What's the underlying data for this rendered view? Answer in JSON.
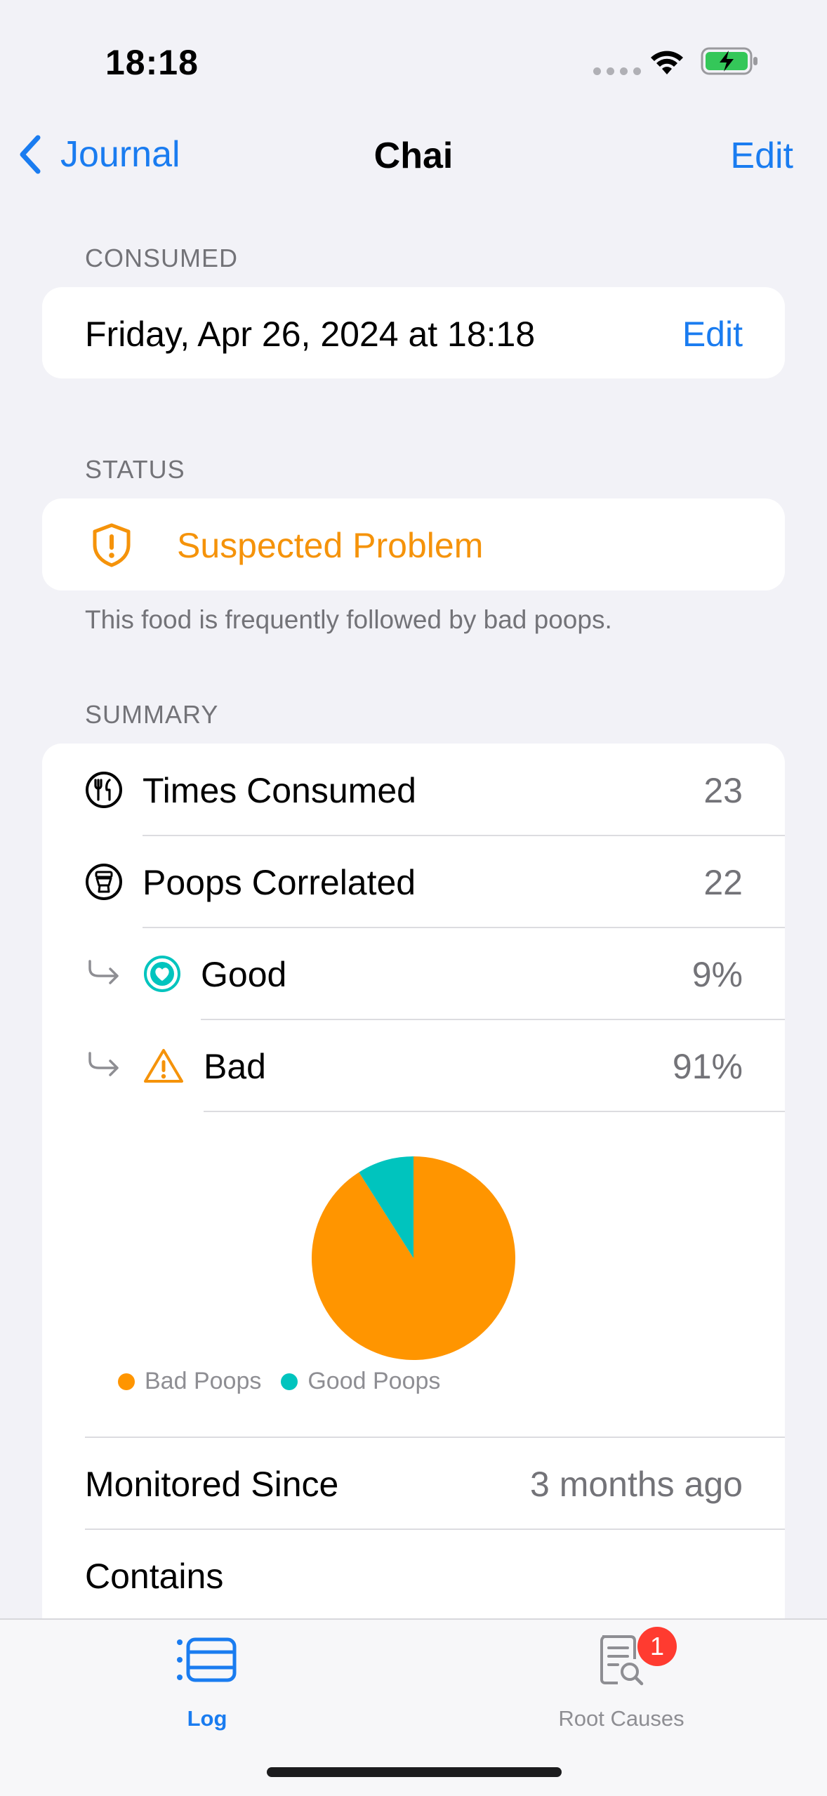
{
  "status_bar": {
    "time": "18:18"
  },
  "nav": {
    "back_label": "Journal",
    "title": "Chai",
    "edit_label": "Edit"
  },
  "consumed": {
    "header": "CONSUMED",
    "date": "Friday, Apr 26, 2024 at 18:18",
    "edit_label": "Edit"
  },
  "status": {
    "header": "STATUS",
    "label": "Suspected Problem",
    "footnote": "This food is frequently followed by bad poops.",
    "color": "#f5930a"
  },
  "summary": {
    "header": "SUMMARY",
    "rows": [
      {
        "icon": "fork-knife-circle-icon",
        "label": "Times Consumed",
        "value": "23"
      },
      {
        "icon": "toilet-circle-icon",
        "label": "Poops Correlated",
        "value": "22"
      },
      {
        "icon": "heart-circle-icon",
        "label": "Good",
        "value": "9%"
      },
      {
        "icon": "warning-triangle-icon",
        "label": "Bad",
        "value": "91%"
      }
    ],
    "monitored_label": "Monitored Since",
    "monitored_value": "3 months ago",
    "contains_label": "Contains"
  },
  "chart_data": {
    "type": "pie",
    "slices": [
      {
        "label": "Bad Poops",
        "value": 91,
        "color": "#ff9500"
      },
      {
        "label": "Good Poops",
        "value": 9,
        "color": "#00c4be"
      }
    ],
    "legend_position": "bottom-left"
  },
  "tabbar": {
    "tabs": [
      {
        "label": "Log",
        "selected": true,
        "icon": "list-icon"
      },
      {
        "label": "Root Causes",
        "selected": false,
        "icon": "document-search-icon"
      }
    ],
    "badge": "1"
  },
  "colors": {
    "accent": "#1a7cf0",
    "warning": "#f5930a",
    "good": "#00c4be"
  }
}
